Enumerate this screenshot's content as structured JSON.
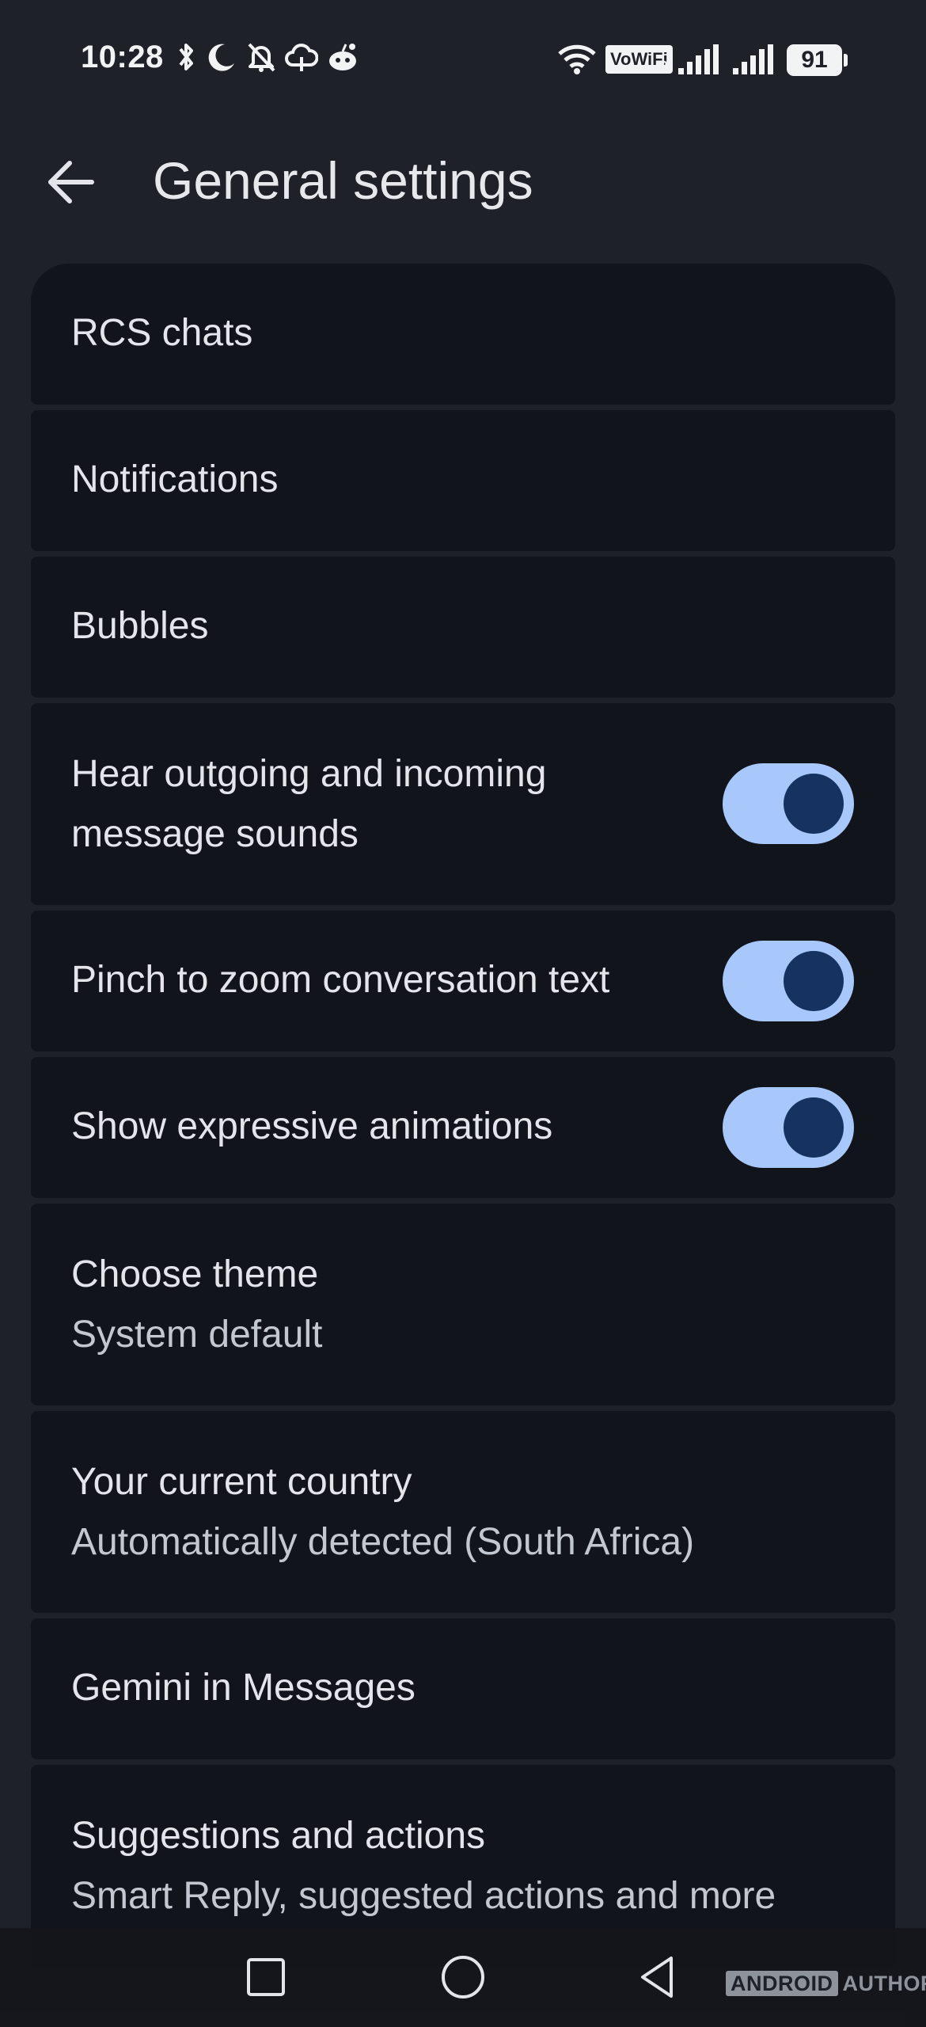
{
  "status_bar": {
    "time": "10:28",
    "vowifi": "VoWiFi",
    "vowifi_sub": "2",
    "battery": "91",
    "icons": [
      "bluetooth-icon",
      "moon-icon",
      "bell-off-icon",
      "cloud-icon",
      "reddit-icon",
      "wifi-icon",
      "signal-icon",
      "signal-icon"
    ]
  },
  "header": {
    "title": "General settings",
    "back_icon": "arrow-left-icon"
  },
  "settings": [
    {
      "label": "RCS chats"
    },
    {
      "label": "Notifications"
    },
    {
      "label": "Bubbles"
    },
    {
      "label_line1": "Hear outgoing and incoming",
      "label_line2": "message sounds",
      "toggle": true
    },
    {
      "label": "Pinch to zoom conversation text",
      "toggle": true
    },
    {
      "label": "Show expressive animations",
      "toggle": true
    },
    {
      "label": "Choose theme",
      "sub": "System default"
    },
    {
      "label": "Your current country",
      "sub": "Automatically detected (South Africa)"
    },
    {
      "label": "Gemini in Messages"
    },
    {
      "label": "Suggestions and actions",
      "sub": "Smart Reply, suggested actions and more"
    }
  ],
  "nav": {
    "icons": [
      "recents-square-icon",
      "home-circle-icon",
      "back-triangle-icon"
    ]
  },
  "watermark": {
    "part1": "ANDROID",
    "part2": "AUTHORITY"
  },
  "colors": {
    "background": "#1e2128",
    "card": "#11141a",
    "toggle_track": "#a8c7fa",
    "toggle_thumb": "#153260"
  }
}
